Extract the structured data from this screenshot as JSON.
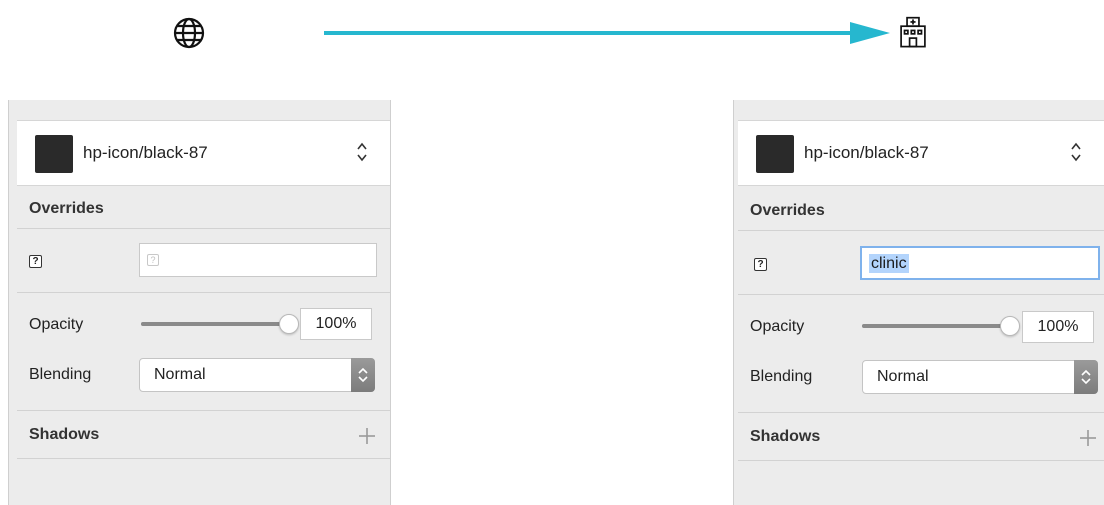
{
  "icons": {
    "source_icon": "globe-icon",
    "target_icon": "hospital-icon",
    "arrow_color": "#26b7cf"
  },
  "panels": [
    {
      "symbol": {
        "name": "hp-icon/black-87",
        "swatch_color": "#2a2a2a"
      },
      "overrides": {
        "title": "Overrides",
        "value": ""
      },
      "opacity": {
        "label": "Opacity",
        "value": "100%",
        "level": 1.0
      },
      "blending": {
        "label": "Blending",
        "value": "Normal"
      },
      "shadows": {
        "title": "Shadows"
      }
    },
    {
      "symbol": {
        "name": "hp-icon/black-87",
        "swatch_color": "#2a2a2a"
      },
      "overrides": {
        "title": "Overrides",
        "value": "clinic"
      },
      "opacity": {
        "label": "Opacity",
        "value": "100%",
        "level": 1.0
      },
      "blending": {
        "label": "Blending",
        "value": "Normal"
      },
      "shadows": {
        "title": "Shadows"
      }
    }
  ]
}
